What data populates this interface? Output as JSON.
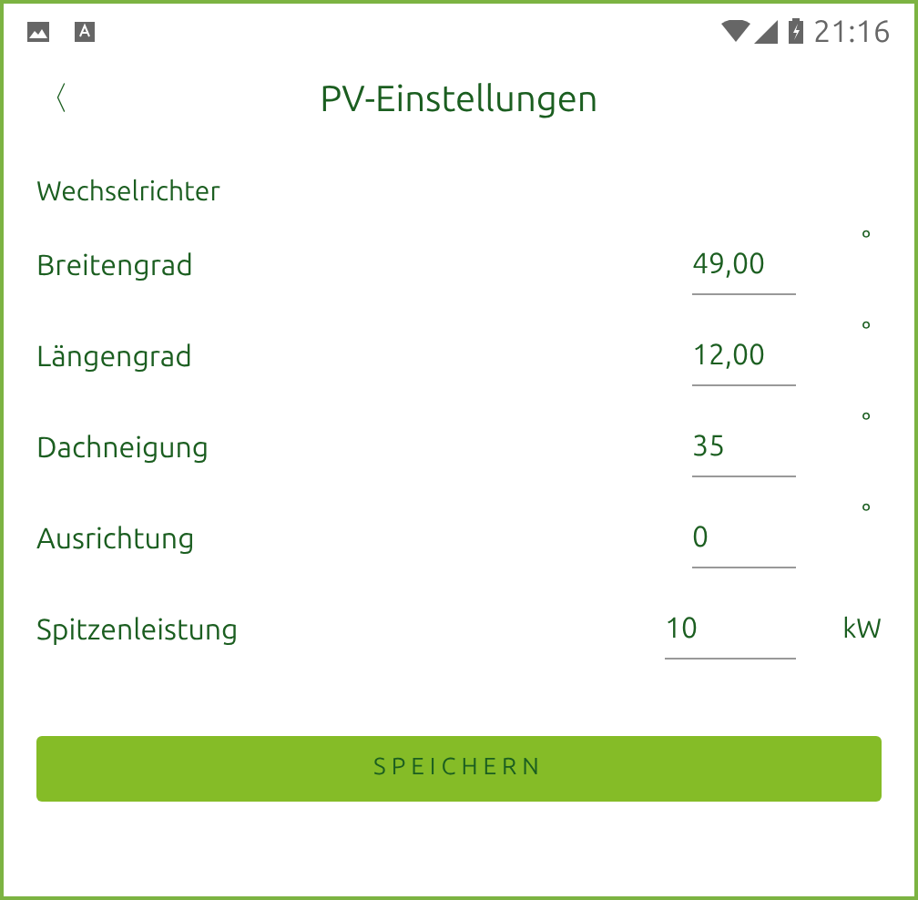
{
  "status_bar": {
    "time": "21:16"
  },
  "header": {
    "back": "〈",
    "title": "PV-Einstellungen"
  },
  "section": "Wechselrichter",
  "fields": [
    {
      "label": "Breitengrad",
      "value": "49,00",
      "unit": "°",
      "kind": "short"
    },
    {
      "label": "Längengrad",
      "value": "12,00",
      "unit": "°",
      "kind": "short"
    },
    {
      "label": "Dachneigung",
      "value": "35",
      "unit": "°",
      "kind": "short"
    },
    {
      "label": "Ausrichtung",
      "value": "0",
      "unit": "°",
      "kind": "short"
    },
    {
      "label": "Spitzenleistung",
      "value": "10",
      "unit": "kW",
      "kind": "wide"
    }
  ],
  "save_button": "SPEICHERN"
}
